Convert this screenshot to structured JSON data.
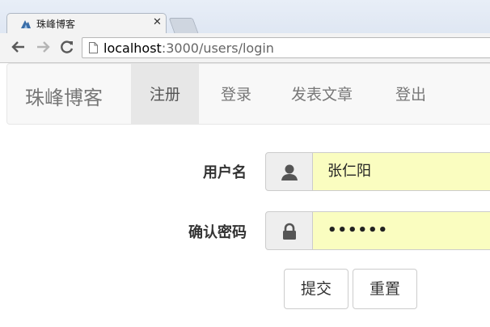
{
  "browser": {
    "tab_title": "珠峰博客",
    "url_host": "localhost",
    "url_path": ":3000/users/login"
  },
  "navbar": {
    "brand": "珠峰博客",
    "items": [
      {
        "label": "注册",
        "active": true
      },
      {
        "label": "登录",
        "active": false
      },
      {
        "label": "发表文章",
        "active": false
      },
      {
        "label": "登出",
        "active": false
      }
    ]
  },
  "form": {
    "username_label": "用户名",
    "username_value": "张仁阳",
    "password_label": "确认密码",
    "password_value": "••••••",
    "submit_label": "提交",
    "reset_label": "重置"
  },
  "colors": {
    "autofill": "#fafdc0",
    "navbar_bg": "#f8f8f8",
    "active_nav_bg": "#e7e7e7"
  }
}
